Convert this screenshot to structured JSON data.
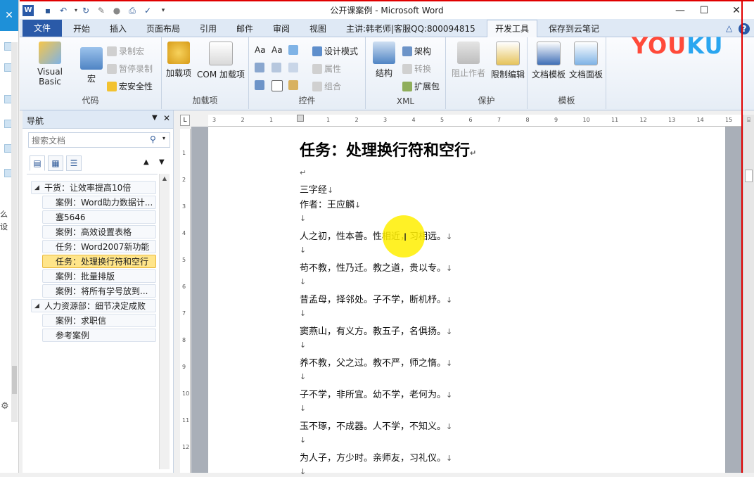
{
  "left_strip": {
    "close": "✕",
    "chars": [
      "么",
      "设"
    ],
    "gear": "⚙"
  },
  "window": {
    "title": "公开课案例  -  Microsoft Word",
    "minimize": "—",
    "maximize": "☐",
    "close": "✕",
    "qat_icons": [
      "word-icon",
      "save-icon",
      "undo-icon",
      "redo-icon",
      "format-painter-icon",
      "circle-icon",
      "print-preview-icon",
      "spellcheck-icon",
      "dropdown-icon"
    ]
  },
  "tabs": [
    "文件",
    "开始",
    "插入",
    "页面布局",
    "引用",
    "邮件",
    "审阅",
    "视图",
    "主讲:韩老师|客服QQ:800094815",
    "开发工具",
    "保存到云笔记"
  ],
  "active_tab": "开发工具",
  "ribbon": {
    "groups": {
      "code": {
        "label": "代码",
        "visual_basic": "Visual Basic",
        "macro": "宏",
        "record_macro": "录制宏",
        "pause_record": "暂停录制",
        "macro_security": "宏安全性"
      },
      "addins": {
        "label": "加载项",
        "addins": "加载项",
        "com_addins": "COM 加载项"
      },
      "controls": {
        "label": "控件",
        "aa1": "Aa",
        "aa2": "Aa",
        "design_mode": "设计模式",
        "properties": "属性",
        "group": "组合"
      },
      "xml": {
        "label": "XML",
        "structure": "结构",
        "schema": "架构",
        "transform": "转换",
        "expansion_pack": "扩展包"
      },
      "protect": {
        "label": "保护",
        "block_authors": "阻止作者",
        "restrict_editing": "限制编辑"
      },
      "templates": {
        "label": "模板",
        "document_template": "文档模板",
        "document_panel": "文档面板"
      }
    }
  },
  "logo": {
    "part1": "YOU",
    "part2": "KU"
  },
  "nav": {
    "title": "导航",
    "search_placeholder": "搜索文档",
    "tree": [
      {
        "label": "干货：让效率提高10倍",
        "level": 1,
        "selected": false
      },
      {
        "label": "案例：Word助力数据计...",
        "level": 2,
        "selected": false
      },
      {
        "label": "塞5646",
        "level": 2,
        "selected": false
      },
      {
        "label": "案例：高效设置表格",
        "level": 2,
        "selected": false
      },
      {
        "label": "任务：Word2007新功能",
        "level": 2,
        "selected": false
      },
      {
        "label": "任务：处理换行符和空行",
        "level": 2,
        "selected": true
      },
      {
        "label": "案例：批量排版",
        "level": 2,
        "selected": false
      },
      {
        "label": "案例：将所有学号放到...",
        "level": 2,
        "selected": false
      },
      {
        "label": "人力资源部：细节决定成败",
        "level": 1,
        "selected": false
      },
      {
        "label": "案例：求职信",
        "level": 2,
        "selected": false
      },
      {
        "label": "参考案例",
        "level": 2,
        "selected": false
      }
    ]
  },
  "ruler": {
    "ticks": [
      "3",
      "2",
      "1",
      "",
      "1",
      "2",
      "3",
      "4",
      "5",
      "6",
      "7",
      "8",
      "9",
      "10",
      "11",
      "12",
      "13",
      "14",
      "15"
    ],
    "vticks": [
      "1",
      "2",
      "3",
      "4",
      "5",
      "6",
      "7",
      "8",
      "9",
      "10",
      "11",
      "12"
    ],
    "corner": "L"
  },
  "document": {
    "title": "任务：处理换行符和空行",
    "title_mark": "↵",
    "line_mark": "↓",
    "para_mark": "↵",
    "lines": [
      "三字经",
      "作者：王应麟",
      "人之初，性本善。性相近，习相远。",
      "苟不教，性乃迁。教之道，贵以专。",
      "昔孟母，择邻处。子不学，断机杼。",
      "窦燕山，有义方。教五子，名俱扬。",
      "养不教，父之过。教不严，师之惰。",
      "子不学，非所宜。幼不学，老何为。",
      "玉不琢，不成器。人不学，不知义。",
      "为人子，方少时。亲师友，习礼仪。"
    ]
  },
  "colors": {
    "file_tab": "#2a5aa8",
    "selected_node": "#ffe58a",
    "highlight": "#ffee00",
    "accent_red": "#e00000"
  }
}
